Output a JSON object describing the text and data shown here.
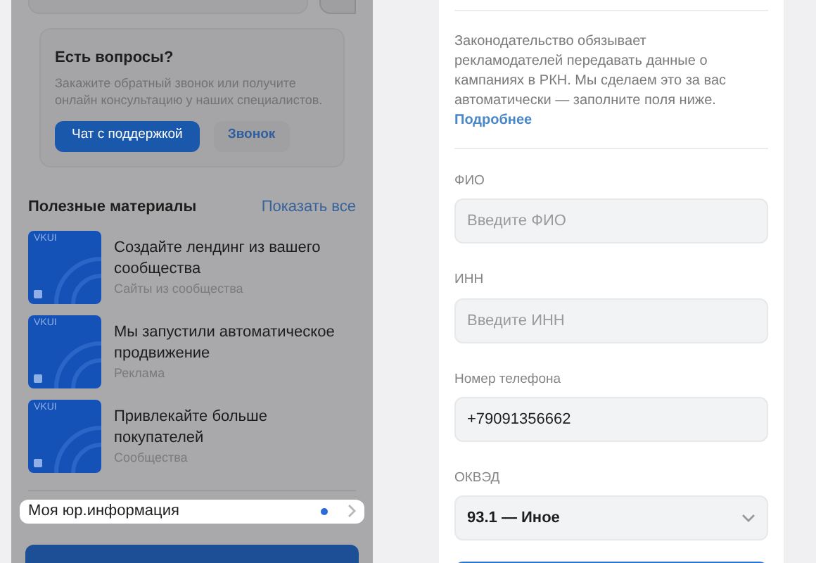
{
  "support": {
    "title": "Есть вопросы?",
    "text": "Закажите обратный звонок или получите онлайн консультацию у наших специалистов.",
    "buttons": [
      {
        "label": "Чат с поддержкой",
        "kind": "primary"
      },
      {
        "label": "Звонок",
        "kind": "secondary"
      }
    ]
  },
  "materials": {
    "title": "Полезные материалы",
    "show_all": "Показать все",
    "items": [
      {
        "title": "Создайте лендинг из вашего сообщества",
        "subtitle": "Сайты из сообщества",
        "thumb": "VKUI"
      },
      {
        "title": "Мы запустили автоматическое продвижение",
        "subtitle": "Реклама",
        "thumb": "VKUI"
      },
      {
        "title": "Привлекайте больше покупателей",
        "subtitle": "Сообщества",
        "thumb": "VKUI"
      }
    ]
  },
  "legal_row": {
    "label": "Моя юр.информация",
    "unread": true
  },
  "form": {
    "notice": "Законодательство обязывает рекламодателей передавать данные о кампаниях в РКН. Мы сделаем это за вас автоматически — заполните поля ниже.",
    "more_link": "Подробнее",
    "fields": [
      {
        "label": "ФИО",
        "kind": "input",
        "placeholder": "Введите ФИО"
      },
      {
        "label": "ИНН",
        "kind": "input",
        "placeholder": "Введите ИНН"
      },
      {
        "label": "Номер телефона",
        "kind": "input",
        "value": "+79091356662"
      },
      {
        "label": "ОКВЭД",
        "kind": "select",
        "value": "93.1 — Иное"
      }
    ]
  }
}
